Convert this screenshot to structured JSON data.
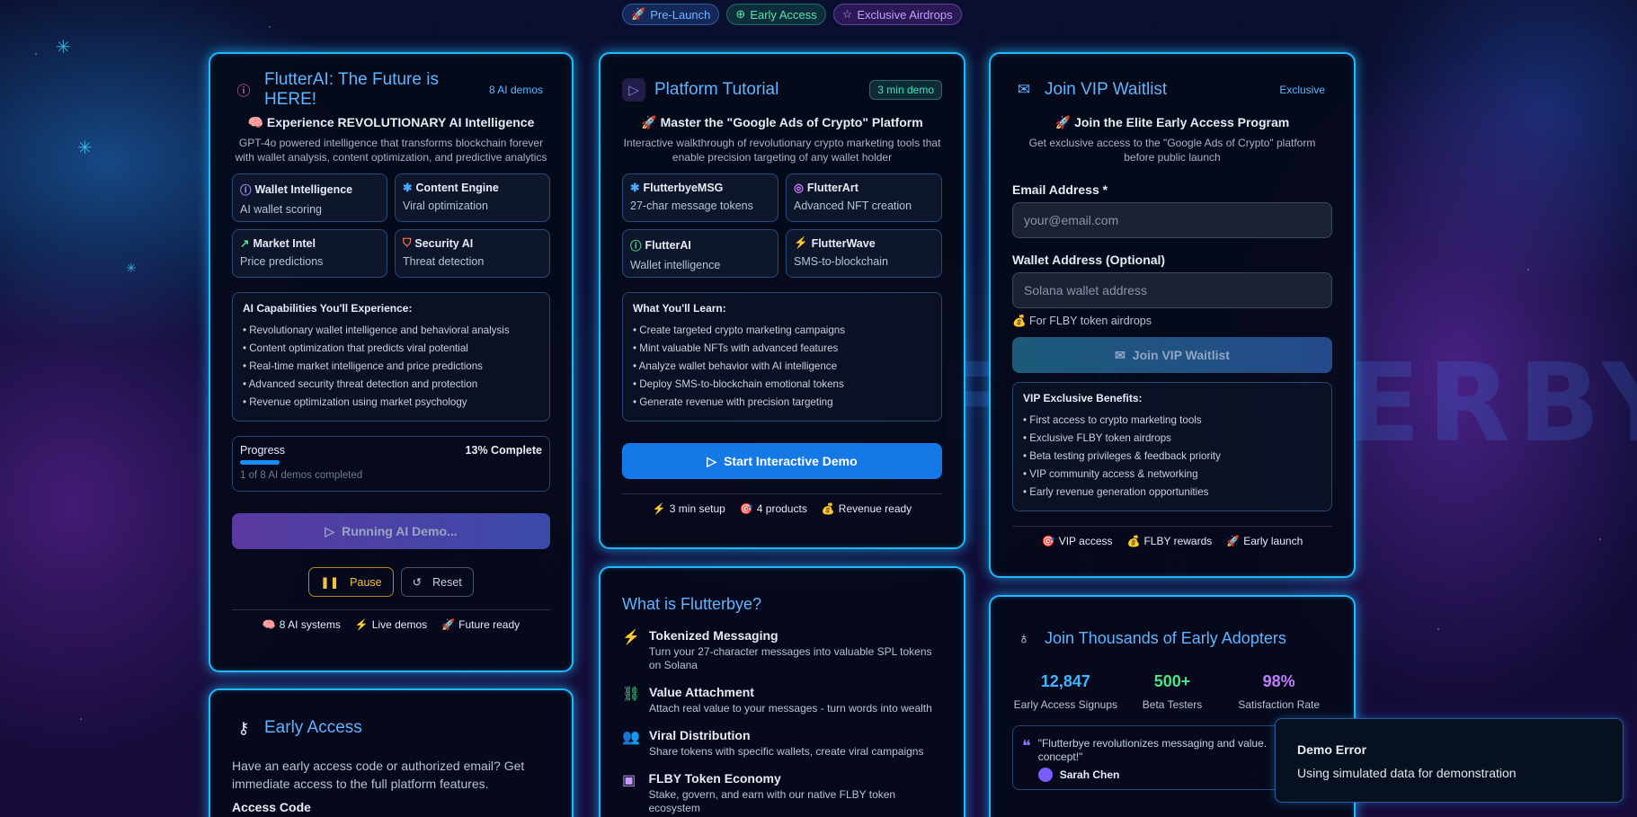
{
  "top_badges": [
    {
      "icon": "🚀",
      "label": "Pre-Launch"
    },
    {
      "icon": "⊕",
      "label": "Early Access"
    },
    {
      "icon": "☆",
      "label": "Exclusive Airdrops"
    }
  ],
  "ai_card": {
    "title": "FlutterAI: The Future is HERE!",
    "pill": "8 AI demos",
    "subtitle": "🧠 Experience REVOLUTIONARY AI Intelligence",
    "desc": "GPT-4o powered intelligence that transforms blockchain forever with wallet analysis, content optimization, and predictive analytics",
    "features": [
      {
        "title": "Wallet Intelligence",
        "desc": "AI wallet scoring",
        "icon": "ⓘ",
        "color": "#b38cff"
      },
      {
        "title": "Content Engine",
        "desc": "Viral optimization",
        "icon": "✱",
        "color": "#4aa8ff"
      },
      {
        "title": "Market Intel",
        "desc": "Price predictions",
        "icon": "↗",
        "color": "#4ee08a"
      },
      {
        "title": "Security AI",
        "desc": "Threat detection",
        "icon": "⛉",
        "color": "#ff7a5a"
      }
    ],
    "capabilities_title": "AI Capabilities You'll Experience:",
    "capabilities": [
      "• Revolutionary wallet intelligence and behavioral analysis",
      "• Content optimization that predicts viral potential",
      "• Real-time market intelligence and price predictions",
      "• Advanced security threat detection and protection",
      "• Revenue optimization using market psychology"
    ],
    "progress_label": "Progress",
    "progress_pct_text": "13% Complete",
    "progress_fraction": 0.13,
    "progress_note": "1 of 8 AI demos completed",
    "run_button": "Running AI Demo...",
    "pause_button": "Pause",
    "reset_button": "Reset",
    "footer": [
      {
        "icon": "🧠",
        "label": "8 AI systems"
      },
      {
        "icon": "⚡",
        "label": "Live demos"
      },
      {
        "icon": "🚀",
        "label": "Future ready"
      }
    ]
  },
  "early_access": {
    "title": "Early Access",
    "desc": "Have an early access code or authorized email? Get immediate access to the full platform features.",
    "next_label": "Access Code"
  },
  "tutorial_card": {
    "title": "Platform Tutorial",
    "pill": "3 min demo",
    "subtitle": "🚀 Master the \"Google Ads of Crypto\" Platform",
    "desc": "Interactive walkthrough of revolutionary crypto marketing tools that enable precision targeting of any wallet holder",
    "features": [
      {
        "title": "FlutterbyeMSG",
        "desc": "27-char message tokens",
        "icon": "✱",
        "color": "#4aa8ff"
      },
      {
        "title": "FlutterArt",
        "desc": "Advanced NFT creation",
        "icon": "◎",
        "color": "#d07cff"
      },
      {
        "title": "FlutterAI",
        "desc": "Wallet intelligence",
        "icon": "ⓘ",
        "color": "#4ee08a"
      },
      {
        "title": "FlutterWave",
        "desc": "SMS-to-blockchain",
        "icon": "⚡",
        "color": "#ffb347"
      }
    ],
    "learn_title": "What You'll Learn:",
    "learn": [
      "• Create targeted crypto marketing campaigns",
      "• Mint valuable NFTs with advanced features",
      "• Analyze wallet behavior with AI intelligence",
      "• Deploy SMS-to-blockchain emotional tokens",
      "• Generate revenue with precision targeting"
    ],
    "start_button": "Start Interactive Demo",
    "footer": [
      {
        "icon": "⚡",
        "label": "3 min setup"
      },
      {
        "icon": "🎯",
        "label": "4 products"
      },
      {
        "icon": "💰",
        "label": "Revenue ready"
      }
    ]
  },
  "about_card": {
    "title": "What is Flutterbye?",
    "items": [
      {
        "icon": "⚡",
        "color": "#f5c242",
        "title": "Tokenized Messaging",
        "desc": "Turn your 27-character messages into valuable SPL tokens on Solana"
      },
      {
        "icon": "⛓",
        "color": "#4ee08a",
        "title": "Value Attachment",
        "desc": "Attach real value to your messages - turn words into wealth"
      },
      {
        "icon": "👥",
        "color": "#4aa8ff",
        "title": "Viral Distribution",
        "desc": "Share tokens with specific wallets, create viral campaigns"
      },
      {
        "icon": "▣",
        "color": "#c89bff",
        "title": "FLBY Token Economy",
        "desc": "Stake, govern, and earn with our native FLBY token ecosystem"
      }
    ]
  },
  "vip_card": {
    "title": "Join VIP Waitlist",
    "pill": "Exclusive",
    "subtitle": "🚀 Join the Elite Early Access Program",
    "desc": "Get exclusive access to the \"Google Ads of Crypto\" platform before public launch",
    "email_label": "Email Address *",
    "email_placeholder": "your@email.com",
    "wallet_label": "Wallet Address (Optional)",
    "wallet_placeholder": "Solana wallet address",
    "wallet_hint": "💰 For FLBY token airdrops",
    "join_button": "Join VIP Waitlist",
    "benefits_title": "VIP Exclusive Benefits:",
    "benefits": [
      "• First access to crypto marketing tools",
      "• Exclusive FLBY token airdrops",
      "• Beta testing privileges & feedback priority",
      "• VIP community access & networking",
      "• Early revenue generation opportunities"
    ],
    "footer": [
      {
        "icon": "🎯",
        "label": "VIP access"
      },
      {
        "icon": "💰",
        "label": "FLBY rewards"
      },
      {
        "icon": "🚀",
        "label": "Early launch"
      }
    ]
  },
  "adopters_card": {
    "title": "Join Thousands of Early Adopters",
    "stats": [
      {
        "value": "12,847",
        "label": "Early Access Signups",
        "color": "#3fb6ff"
      },
      {
        "value": "500+",
        "label": "Beta Testers",
        "color": "#4ee08a"
      },
      {
        "value": "98%",
        "label": "Satisfaction Rate",
        "color": "#c27cff"
      }
    ],
    "quote": "\"Flutterbye revolutionizes messaging and value. concept!\"",
    "quote_author": "Sarah Chen"
  },
  "toast": {
    "title": "Demo Error",
    "message": "Using simulated data for demonstration"
  },
  "watermark": "FLUTTERBYE"
}
